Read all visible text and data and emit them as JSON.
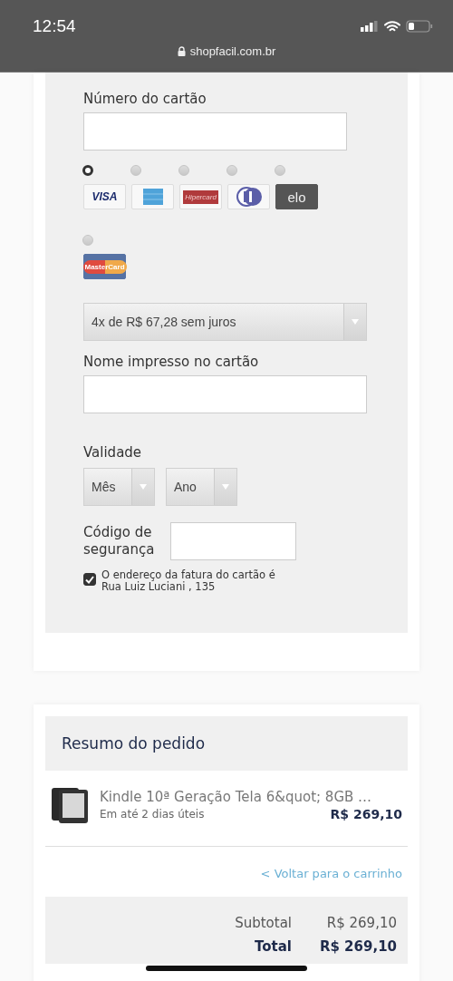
{
  "status_bar": {
    "time": "12:54",
    "url": "shopfacil.com.br"
  },
  "payment": {
    "card_number_label": "Número do cartão",
    "cards": [
      {
        "kind": "visa",
        "logo": "VISA",
        "selected": true
      },
      {
        "kind": "amex",
        "selected": false
      },
      {
        "kind": "hipercard",
        "logo": "Hipercard",
        "selected": false
      },
      {
        "kind": "diners",
        "selected": false
      },
      {
        "kind": "elo",
        "logo": "elo",
        "selected": false
      },
      {
        "kind": "mastercard",
        "logo": "MasterCard",
        "selected": false
      }
    ],
    "installments": "4x de R$ 67,28 sem juros",
    "name_label": "Nome impresso no cartão",
    "validity_label": "Validade",
    "month": "Mês",
    "year": "Ano",
    "security_label": "Código de segurança",
    "billing": {
      "checked": true,
      "text": "O endereço da fatura do cartão é Rua Luiz Luciani , 135"
    }
  },
  "summary": {
    "title": "Resumo do pedido",
    "item": {
      "name": "Kindle 10ª Geração Tela 6&quot; 8GB …",
      "delivery": "Em até 2 dias úteis",
      "price": "R$ 269,10"
    },
    "back_link": "<  Voltar para o carrinho",
    "subtotal_label": "Subtotal",
    "subtotal": "R$ 269,10",
    "total_label": "Total",
    "total": "R$ 269,10"
  }
}
